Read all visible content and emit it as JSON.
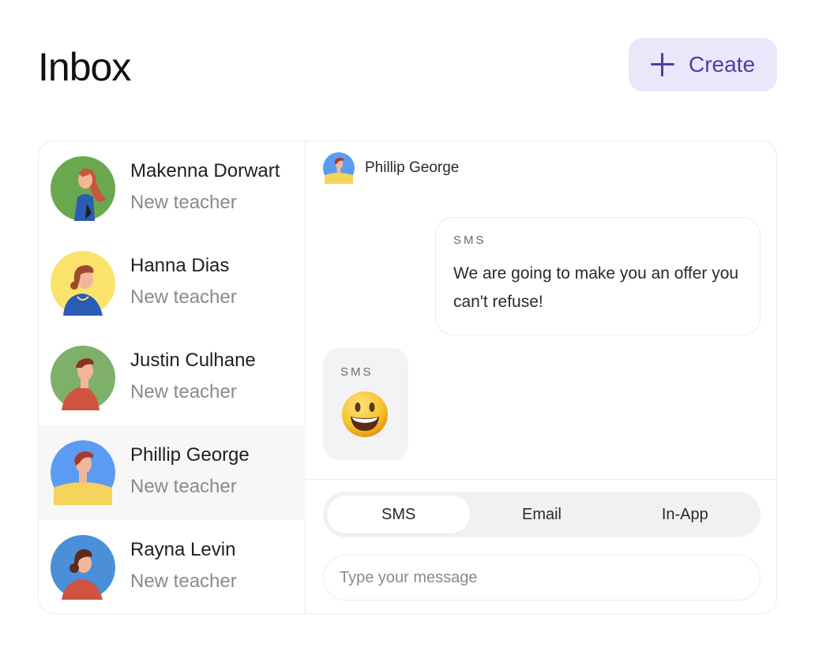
{
  "header": {
    "title": "Inbox",
    "create_label": "Create"
  },
  "contacts": [
    {
      "name": "Makenna Dorwart",
      "role": "New teacher",
      "bg": "#6aa84f",
      "active": false
    },
    {
      "name": "Hanna Dias",
      "role": "New teacher",
      "bg": "#fbe26b",
      "active": false
    },
    {
      "name": "Justin Culhane",
      "role": "New teacher",
      "bg": "#7fb06a",
      "active": false
    },
    {
      "name": "Phillip George",
      "role": "New teacher",
      "bg": "#5b9cf2",
      "active": true
    },
    {
      "name": "Rayna Levin",
      "role": "New teacher",
      "bg": "#4a8fd8",
      "active": false
    }
  ],
  "chat": {
    "contact_name": "Phillip George",
    "messages": [
      {
        "direction": "outgoing",
        "channel": "SMS",
        "text": "We are going to make you an offer you can't refuse!"
      },
      {
        "direction": "incoming",
        "channel": "SMS",
        "emoji": "grinning-face"
      }
    ],
    "tabs": [
      "SMS",
      "Email",
      "In-App"
    ],
    "selected_tab": "SMS",
    "input_placeholder": "Type your message"
  }
}
